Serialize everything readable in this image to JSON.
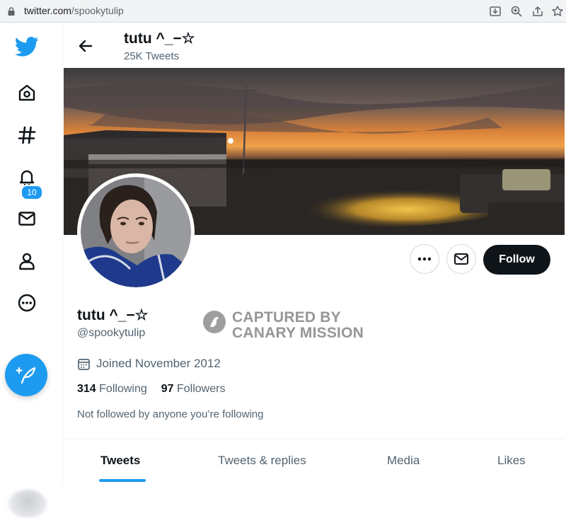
{
  "browser": {
    "url_host": "twitter.com",
    "url_path": "/spookytulip",
    "icons": [
      "lock-icon",
      "install-icon",
      "zoom-icon",
      "share-icon",
      "bookmark-star-icon"
    ]
  },
  "nav": {
    "items": [
      "twitter-logo-icon",
      "home-icon",
      "explore-hashtag-icon",
      "notifications-bell-icon",
      "messages-mail-icon",
      "profile-person-icon",
      "more-circle-icon"
    ],
    "notification_count": "10",
    "compose_icon": "compose-feather-icon"
  },
  "header": {
    "name": "tutu ^_−☆",
    "tweet_count": "25K Tweets"
  },
  "profile": {
    "name": "tutu ^_−☆",
    "handle": "@spookytulip",
    "joined": "Joined November 2012",
    "following_count": "314",
    "following_label": "Following",
    "followers_count": "97",
    "followers_label": "Followers",
    "not_followed": "Not followed by anyone you’re following"
  },
  "actions": {
    "follow_label": "Follow"
  },
  "watermark": {
    "line1": "CAPTURED BY",
    "line2": "CANARY MISSION"
  },
  "tabs": [
    {
      "label": "Tweets",
      "active": true
    },
    {
      "label": "Tweets & replies",
      "active": false
    },
    {
      "label": "Media",
      "active": false
    },
    {
      "label": "Likes",
      "active": false
    }
  ],
  "colors": {
    "accent": "#1d9bf0",
    "text": "#0f1419",
    "secondary": "#536471",
    "follow_button": "#0f1419"
  }
}
